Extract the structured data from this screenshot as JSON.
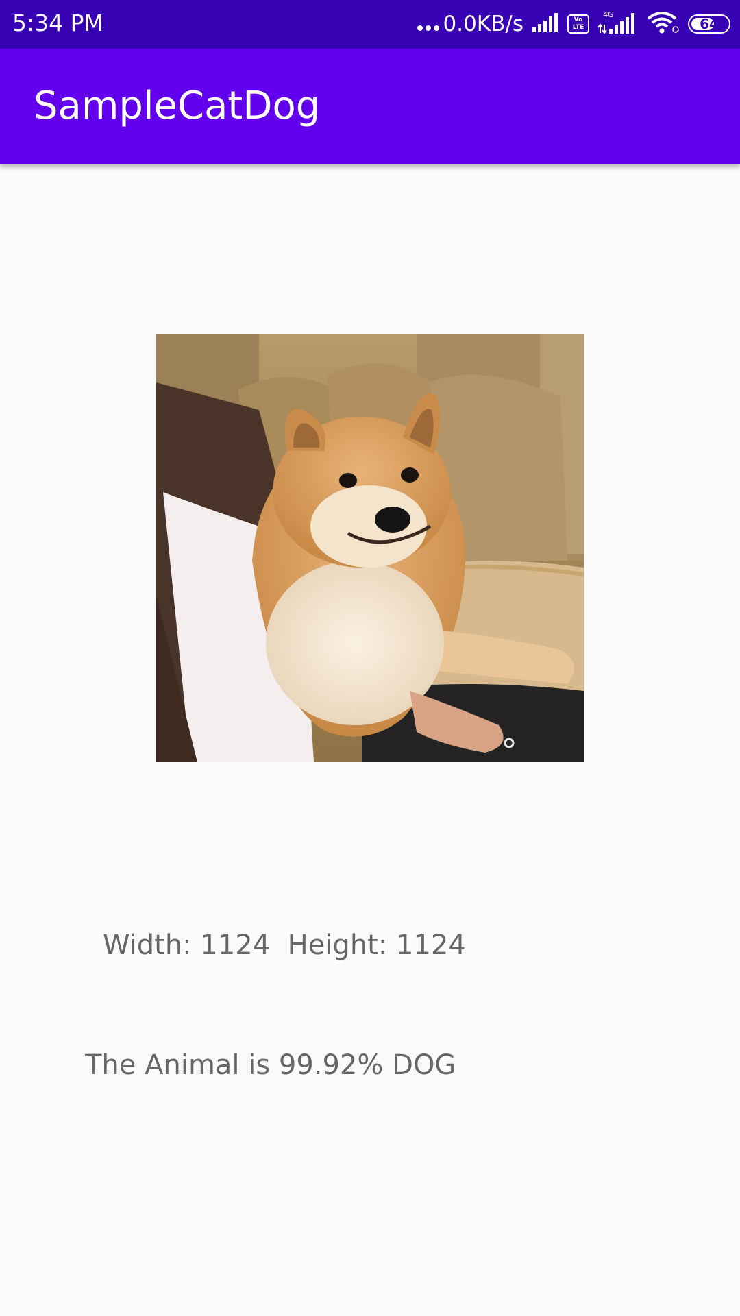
{
  "status_bar": {
    "time": "5:34 PM",
    "net_speed": "0.0KB/s",
    "network_type": "4G",
    "volte_label": "Vo\nLTE",
    "battery_level": 64,
    "battery_text": "64",
    "icons": [
      "more-dots-icon",
      "signal-icon",
      "volte-icon",
      "signal-4g-icon",
      "wifi-icon",
      "battery-icon"
    ]
  },
  "app_bar": {
    "title": "SampleCatDog",
    "background": "#6200ee",
    "status_background": "#3700b3"
  },
  "main": {
    "image_name": "shiba-inu-photo",
    "dimensions_text": "Width: 1124  Height: 1124",
    "result_text": "The Animal is 99.92% DOG"
  }
}
